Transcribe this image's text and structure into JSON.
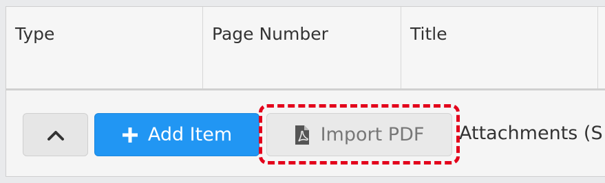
{
  "table": {
    "columns": [
      "Type",
      "Page Number",
      "Title"
    ]
  },
  "toolbar": {
    "add_item_label": "Add Item",
    "import_pdf_label": "Import PDF",
    "attachments_label": "Attachments (S"
  },
  "icons": {
    "collapse": "chevron-up-icon",
    "add": "plus-icon",
    "import": "pdf-file-icon"
  },
  "colors": {
    "primary": "#2196f3",
    "highlight": "#e3001b"
  }
}
